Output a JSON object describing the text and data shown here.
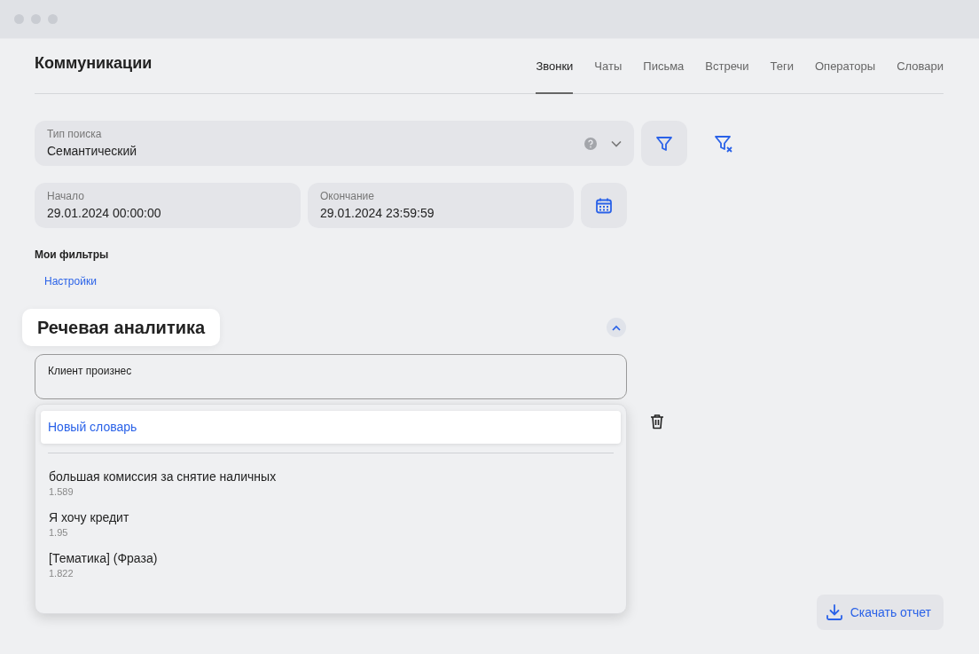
{
  "title": "Коммуникации",
  "tabs": [
    {
      "label": "Звонки",
      "selected": true
    },
    {
      "label": "Чаты",
      "selected": false
    },
    {
      "label": "Письма",
      "selected": false
    },
    {
      "label": "Встречи",
      "selected": false
    },
    {
      "label": "Теги",
      "selected": false
    },
    {
      "label": "Операторы",
      "selected": false
    },
    {
      "label": "Словари",
      "selected": false
    }
  ],
  "search_type": {
    "label": "Тип поиска",
    "value": "Семантический"
  },
  "date_start": {
    "label": "Начало",
    "value": "29.01.2024 00:00:00"
  },
  "date_end": {
    "label": "Окончание",
    "value": "29.01.2024 23:59:59"
  },
  "my_filters": {
    "title": "Мои фильтры",
    "link": "Настройки"
  },
  "speech_analytics": {
    "title": "Речевая аналитика",
    "expanded": true,
    "phrase_field": {
      "label": "Клиент произнес"
    },
    "dropdown": {
      "new_item": {
        "label": "Новый словарь",
        "selected": true
      },
      "items": [
        {
          "name": "большая комиссия за снятие наличных",
          "count": "1.589",
          "selected": false
        },
        {
          "name": "Я хочу кредит",
          "count": "1.95",
          "selected": false
        },
        {
          "name": "[Тематика] (Фраза)",
          "count": "1.822",
          "selected": false
        }
      ]
    }
  },
  "download_button": {
    "label": "Скачать отчет"
  }
}
